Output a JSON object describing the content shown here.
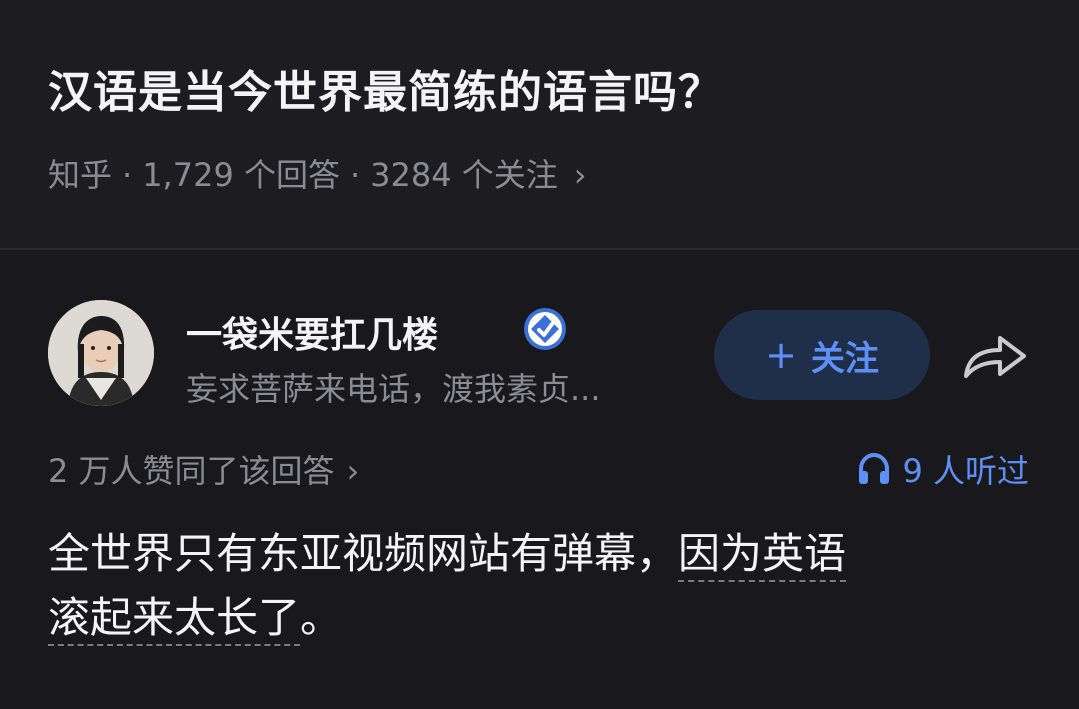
{
  "question": {
    "title": "汉语是当今世界最简练的语言吗？",
    "source": "知乎",
    "answers_count": "1,729 个回答",
    "followers_count": "3284 个关注",
    "chevron": "›"
  },
  "answer": {
    "author": {
      "name": "一袋米要扛几楼",
      "bio": "妄求菩萨来电话，渡我素贞...",
      "badge_icon": "verified-badge-icon",
      "avatar_icon": "avatar-photo"
    },
    "follow_button": {
      "plus": "+",
      "label": "关注"
    },
    "share_icon": "share-arrow-icon",
    "upvotes": "2 万人赞同了该回答",
    "upvotes_chevron": "›",
    "listened": "9 人听过",
    "listen_icon": "headphones-icon",
    "content": {
      "part1": "全世界只有东亚视频网站有弹幕，",
      "part2_underlined": "因为英语",
      "part3_underlined": "滚起来太长了",
      "part4": "。"
    }
  },
  "colors": {
    "background": "#1a1a1f",
    "accent": "#5e8ff5",
    "secondary_text": "#8b8b93",
    "follow_button_bg": "#1f2f4a"
  }
}
